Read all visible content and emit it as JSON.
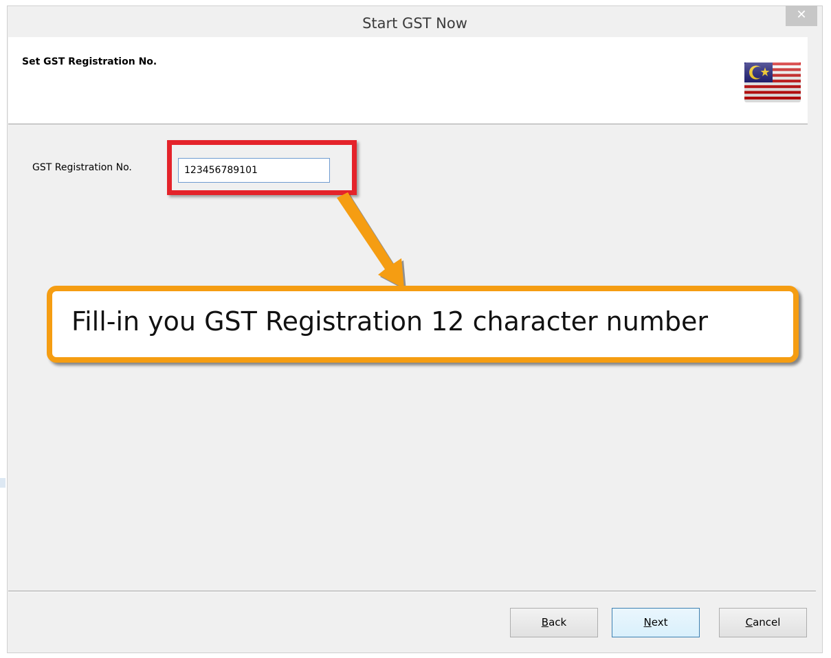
{
  "window": {
    "title": "Start GST Now",
    "close_label": "✕"
  },
  "header": {
    "title": "Set GST Registration No.",
    "flag_icon": "malaysia-flag-icon"
  },
  "form": {
    "label": "GST Registration No.",
    "value": "123456789101"
  },
  "callout": {
    "text": "Fill-in you GST Registration 12 character number"
  },
  "buttons": {
    "back": {
      "mnemonic": "B",
      "rest": "ack"
    },
    "next": {
      "mnemonic": "N",
      "rest": "ext"
    },
    "cancel": {
      "mnemonic": "C",
      "rest": "ancel"
    }
  },
  "colors": {
    "highlight": "#e4232a",
    "callout_border": "#f59d12",
    "input_border": "#6e9bd0"
  }
}
